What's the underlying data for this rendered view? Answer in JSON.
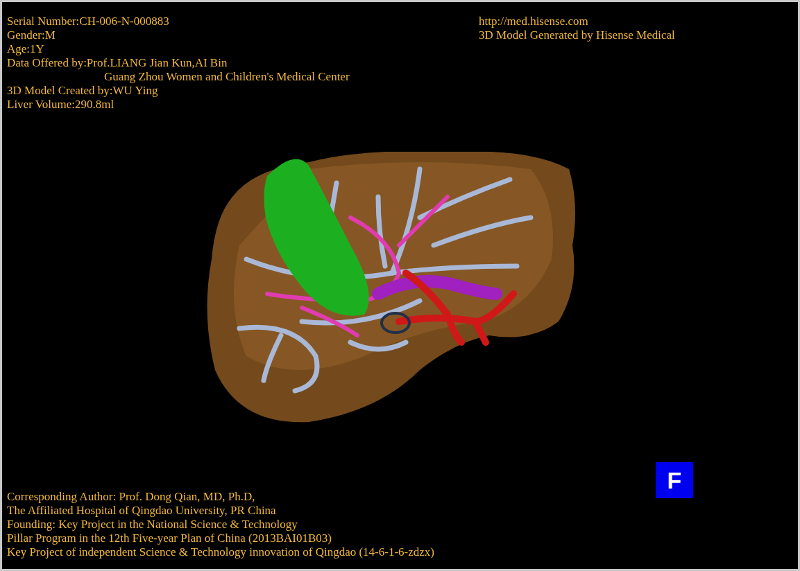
{
  "info_top_left": [
    {
      "kind": "line",
      "text": "Serial Number:CH-006-N-000883"
    },
    {
      "kind": "line",
      "text": "Gender:M"
    },
    {
      "kind": "line",
      "text": "Age:1Y"
    },
    {
      "kind": "line",
      "text": "Data Offered by:Prof.LIANG Jian Kun,AI Bin"
    },
    {
      "kind": "continuation",
      "text": "Guang Zhou Women and Children's Medical Center"
    },
    {
      "kind": "line",
      "text": "3D Model Created by:WU Ying"
    },
    {
      "kind": "line",
      "text": "Liver Volume:290.8ml"
    }
  ],
  "info_top_right": [
    "http://med.hisense.com",
    "3D Model Generated by Hisense Medical"
  ],
  "info_bottom_left": [
    "Corresponding Author: Prof. Dong Qian, MD, Ph.D,",
    "The Affiliated Hospital of Qingdao University, PR China",
    "Founding: Key Project in the National Science & Technology",
    "Pillar Program in the 12th Five-year Plan of China (2013BAI01B03)",
    "Key Project of independent Science & Technology innovation of Qingdao (14-6-1-6-zdzx)"
  ],
  "orientation_marker": {
    "label": "F"
  }
}
